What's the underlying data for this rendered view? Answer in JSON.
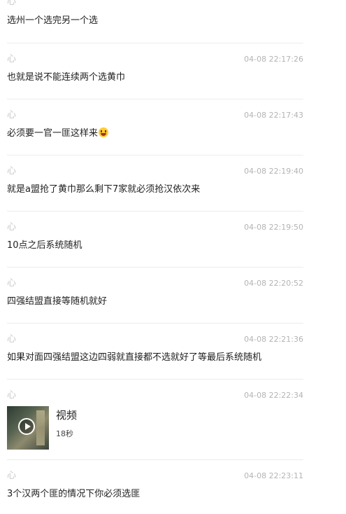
{
  "messages": [
    {
      "icon": "heart-outline",
      "time": "",
      "text": "选州一个选完另一个选"
    },
    {
      "icon": "heart-outline",
      "time": "04-08 22:17:26",
      "text": "也就是说不能连续两个选黄巾"
    },
    {
      "icon": "heart-outline",
      "time": "04-08 22:17:43",
      "text": "必须要一官一匪这样来",
      "emoji": "laughing-face"
    },
    {
      "icon": "heart-outline",
      "time": "04-08 22:19:40",
      "text": "就是a盟抢了黄巾那么剩下7家就必须抢汉依次来"
    },
    {
      "icon": "heart-outline",
      "time": "04-08 22:19:50",
      "text": "10点之后系统随机"
    },
    {
      "icon": "heart-outline",
      "time": "04-08 22:20:52",
      "text": "四强结盟直接等随机就好"
    },
    {
      "icon": "heart-outline",
      "time": "04-08 22:21:36",
      "text": "如果对面四强结盟这边四弱就直接都不选就好了等最后系统随机"
    },
    {
      "icon": "heart-outline",
      "time": "04-08 22:22:34",
      "video": {
        "title": "视频",
        "duration": "18秒"
      }
    },
    {
      "icon": "heart-outline",
      "time": "04-08 22:23:11",
      "text": "3个汉两个匪的情况下你必须选匪"
    }
  ],
  "glyphs": {
    "heart": "心"
  },
  "colors": {
    "timestamp": "#b4b4b4",
    "divider": "#ececec",
    "text": "#1e1e1e"
  }
}
